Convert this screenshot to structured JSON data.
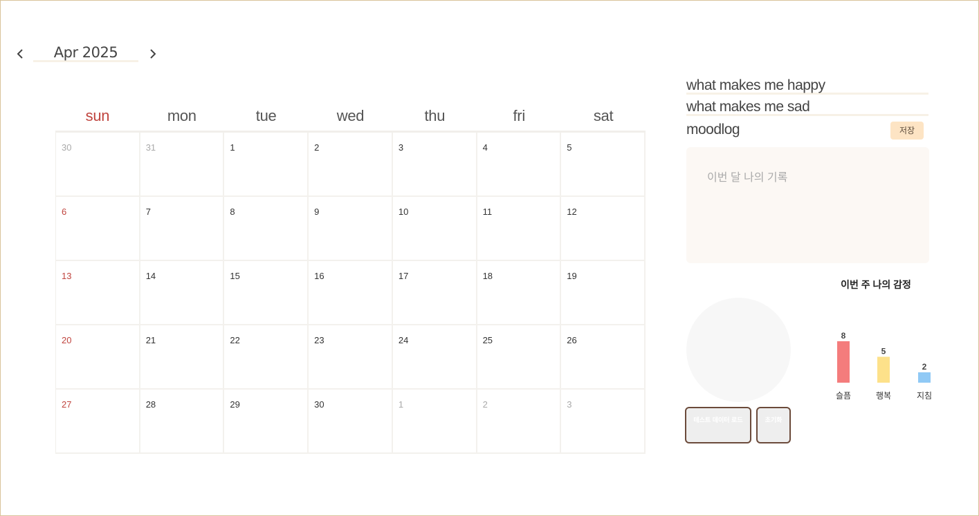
{
  "month_nav": {
    "title": "Apr 2025"
  },
  "calendar": {
    "weekdays": [
      "sun",
      "mon",
      "tue",
      "wed",
      "thu",
      "fri",
      "sat"
    ],
    "days": [
      {
        "d": "30",
        "other": true
      },
      {
        "d": "31",
        "other": true
      },
      {
        "d": "1"
      },
      {
        "d": "2"
      },
      {
        "d": "3"
      },
      {
        "d": "4"
      },
      {
        "d": "5"
      },
      {
        "d": "6"
      },
      {
        "d": "7"
      },
      {
        "d": "8"
      },
      {
        "d": "9"
      },
      {
        "d": "10"
      },
      {
        "d": "11"
      },
      {
        "d": "12"
      },
      {
        "d": "13"
      },
      {
        "d": "14"
      },
      {
        "d": "15"
      },
      {
        "d": "16"
      },
      {
        "d": "17"
      },
      {
        "d": "18"
      },
      {
        "d": "19"
      },
      {
        "d": "20"
      },
      {
        "d": "21"
      },
      {
        "d": "22"
      },
      {
        "d": "23"
      },
      {
        "d": "24"
      },
      {
        "d": "25"
      },
      {
        "d": "26"
      },
      {
        "d": "27"
      },
      {
        "d": "28"
      },
      {
        "d": "29"
      },
      {
        "d": "30"
      },
      {
        "d": "1",
        "other": true
      },
      {
        "d": "2",
        "other": true
      },
      {
        "d": "3",
        "other": true
      }
    ]
  },
  "panel": {
    "happy_label": "what makes me happy",
    "sad_label": "what makes me sad",
    "moodlog_label": "moodlog",
    "save_label": "저장",
    "memo_placeholder": "이번 달 나의 기록",
    "emotion_title": "이번 주 나의 감정",
    "test_button": "테스트 데이터 로드",
    "reset_button": "초기화"
  },
  "colors": {
    "sunday": "#c0453f",
    "sad": "#f47c7c",
    "happy": "#fde18a",
    "tired": "#90c9f5"
  },
  "chart_data": {
    "type": "bar",
    "categories": [
      "슬픔",
      "행복",
      "지침"
    ],
    "values": [
      8,
      5,
      2
    ],
    "title": "이번 주 나의 감정",
    "xlabel": "",
    "ylabel": ""
  }
}
